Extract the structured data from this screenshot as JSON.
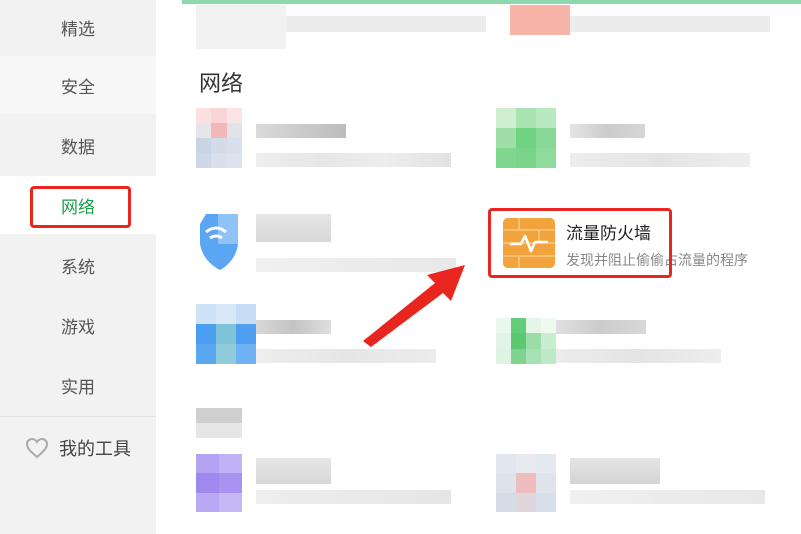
{
  "sidebar": {
    "items": [
      {
        "label": "精选"
      },
      {
        "label": "安全"
      },
      {
        "label": "数据"
      },
      {
        "label": "网络"
      },
      {
        "label": "系统"
      },
      {
        "label": "游戏"
      },
      {
        "label": "实用"
      }
    ],
    "my_tools": "我的工具",
    "active_index": 3
  },
  "main": {
    "section_title": "网络",
    "highlighted_tool": {
      "name": "流量防火墙",
      "description": "发现并阻止偷偷占流量的程序",
      "icon": "firewall-pulse-icon",
      "icon_color": "#f3a33e"
    }
  },
  "colors": {
    "accent": "#1a9e4b",
    "highlight_border": "#e8251f",
    "top_bar": "#8ed8ad"
  }
}
